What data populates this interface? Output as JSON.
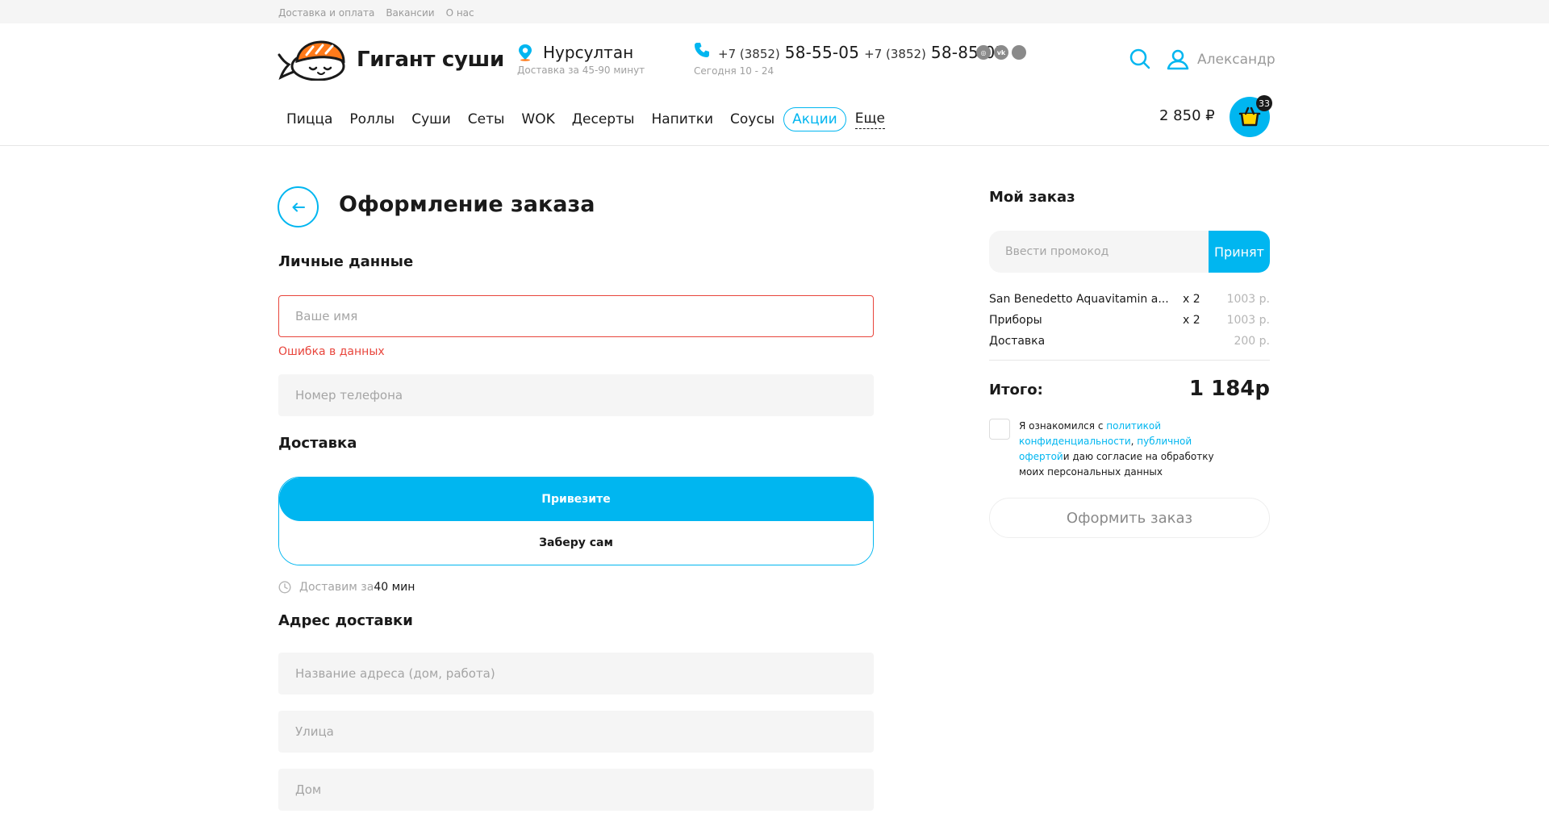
{
  "topbar": {
    "links": [
      "Доставка и оплата",
      "Вакансии",
      "О нас"
    ]
  },
  "header": {
    "brand": "Гигант суши",
    "city": {
      "name": "Нурсултан",
      "delivery_time": "Доставка за 45-90 минут"
    },
    "phones": [
      {
        "prefix": "+7 (3852)",
        "number": "58-55-05"
      },
      {
        "prefix": "+7 (3852)",
        "number": "58-85-05"
      }
    ],
    "hours": "Сегодня 10 - 24",
    "socials": [
      "instagram-icon",
      "vk-icon",
      "social-icon"
    ],
    "user_name": "Александр",
    "nav": [
      "Пицца",
      "Роллы",
      "Суши",
      "Сеты",
      "WOK",
      "Десерты",
      "Напитки",
      "Соусы",
      "Акции",
      "Еще"
    ],
    "cart_total": "2 850 ₽",
    "cart_count": "33"
  },
  "checkout": {
    "title": "Оформление заказа",
    "personal_title": "Личные данные",
    "name_placeholder": "Ваше имя",
    "name_error": "Ошибка в данных",
    "phone_placeholder": "Номер телефона",
    "delivery_title": "Доставка",
    "delivery_options": [
      "Привезите",
      "Заберу сам"
    ],
    "eta_label": "Доставим за",
    "eta_value": "40 мин",
    "address_title": "Адрес доставки",
    "address_name_placeholder": "Название адреса (дом, работа)",
    "street_placeholder": "Улица",
    "house_placeholder": "Дом"
  },
  "order": {
    "title": "Мой заказ",
    "promo_placeholder": "Ввести промокод",
    "promo_button": "Принят",
    "items": [
      {
        "name": "San Benedetto Aquavitamin a...",
        "qty": "x 2",
        "price": "1003 р."
      },
      {
        "name": "Приборы",
        "qty": "x 2",
        "price": "1003 р."
      },
      {
        "name": "Доставка",
        "qty": "",
        "price": "200 р."
      }
    ],
    "total_label": "Итого:",
    "total_value": "1 184р",
    "agree": {
      "prefix": "Я ознакомился с ",
      "privacy_link": "политикой конфиденциальности",
      "comma": ", ",
      "offer_link": "публичной офертой",
      "suffix": "и даю согласие на обработку моих персональных данных"
    },
    "submit": "Оформить заказ"
  },
  "colors": {
    "accent": "#00b6f0",
    "error": "#e8453c",
    "logo_orange": "#ff7a1a"
  }
}
